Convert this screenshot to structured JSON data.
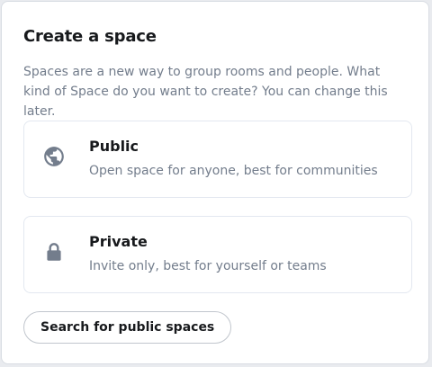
{
  "dialog": {
    "title": "Create a space",
    "description": "Spaces are a new way to group rooms and people. What kind of Space do you want to create? You can change this later."
  },
  "options": [
    {
      "title": "Public",
      "description": "Open space for anyone, best for communities",
      "icon": "globe-icon"
    },
    {
      "title": "Private",
      "description": "Invite only, best for yourself or teams",
      "icon": "lock-icon"
    }
  ],
  "actions": {
    "search_label": "Search for public spaces"
  },
  "colors": {
    "text_primary": "#17191c",
    "text_secondary": "#737d8c",
    "icon": "#737d8c",
    "border": "#e3e8f0"
  }
}
